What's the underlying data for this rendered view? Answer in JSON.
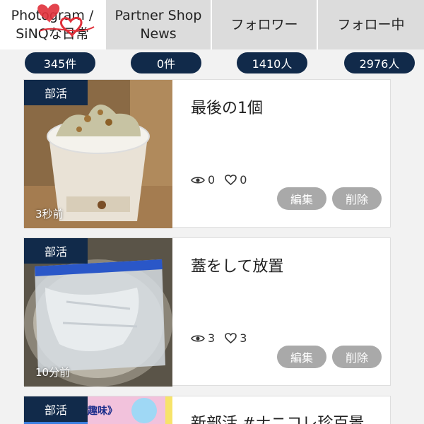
{
  "tabs": [
    {
      "line1": "Photogram /",
      "line2": "SiNQな日常"
    },
    {
      "line1": "Partner Shop",
      "line2": "News"
    },
    {
      "line1": "フォロワー",
      "line2": ""
    },
    {
      "line1": "フォロー中",
      "line2": ""
    }
  ],
  "counts": [
    "345件",
    "0件",
    "1410人",
    "2976人"
  ],
  "posts": [
    {
      "category": "部活",
      "time": "3秒前",
      "title": "最後の1個",
      "views": "0",
      "likes": "0",
      "edit": "編集",
      "delete": "削除"
    },
    {
      "category": "部活",
      "time": "10分前",
      "title": "蓋をして放置",
      "views": "3",
      "likes": "3",
      "edit": "編集",
      "delete": "削除"
    },
    {
      "category": "部活",
      "time": "",
      "title": "新部活 #ナニコレ珍百景",
      "thumb_text": "趣味》",
      "views": "",
      "likes": "",
      "edit": "",
      "delete": ""
    }
  ],
  "colors": {
    "navy": "#112a4a",
    "button_gray": "#a9a9a9",
    "tab_inactive": "#dcdcdc",
    "heart_red": "#e0303a"
  }
}
